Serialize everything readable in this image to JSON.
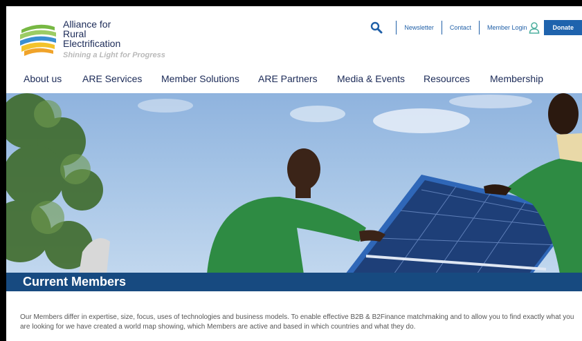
{
  "brand": {
    "name_lines": [
      "Alliance for",
      "Rural",
      "Electrification"
    ],
    "tagline": "Shining a Light for Progress"
  },
  "utility": {
    "search_icon": "search-icon",
    "newsletter": "Newsletter",
    "contact": "Contact",
    "member_login": "Member Login",
    "user_icon": "user-icon",
    "donate": "Donate"
  },
  "nav": {
    "items": [
      {
        "label": "About us"
      },
      {
        "label": "ARE Services"
      },
      {
        "label": "Member Solutions"
      },
      {
        "label": "ARE Partners"
      },
      {
        "label": "Media & Events"
      },
      {
        "label": "Resources"
      },
      {
        "label": "Membership"
      }
    ]
  },
  "page": {
    "title": "Current Members",
    "intro": "Our Members differ in expertise, size, focus, uses of technologies and business models. To enable effective B2B & B2Finance matchmaking and to allow you to find exactly what you are looking for we have created a world map showing, which Members are active and based in which countries and what they do."
  },
  "colors": {
    "brand_navy": "#1b2a57",
    "link_blue": "#1f5fa7",
    "donate_bg": "#1f63ad",
    "banner_bg": "#174a80",
    "logo_green": "#77b843",
    "logo_yellow": "#f3c32b",
    "logo_blue": "#3a8fd1"
  }
}
